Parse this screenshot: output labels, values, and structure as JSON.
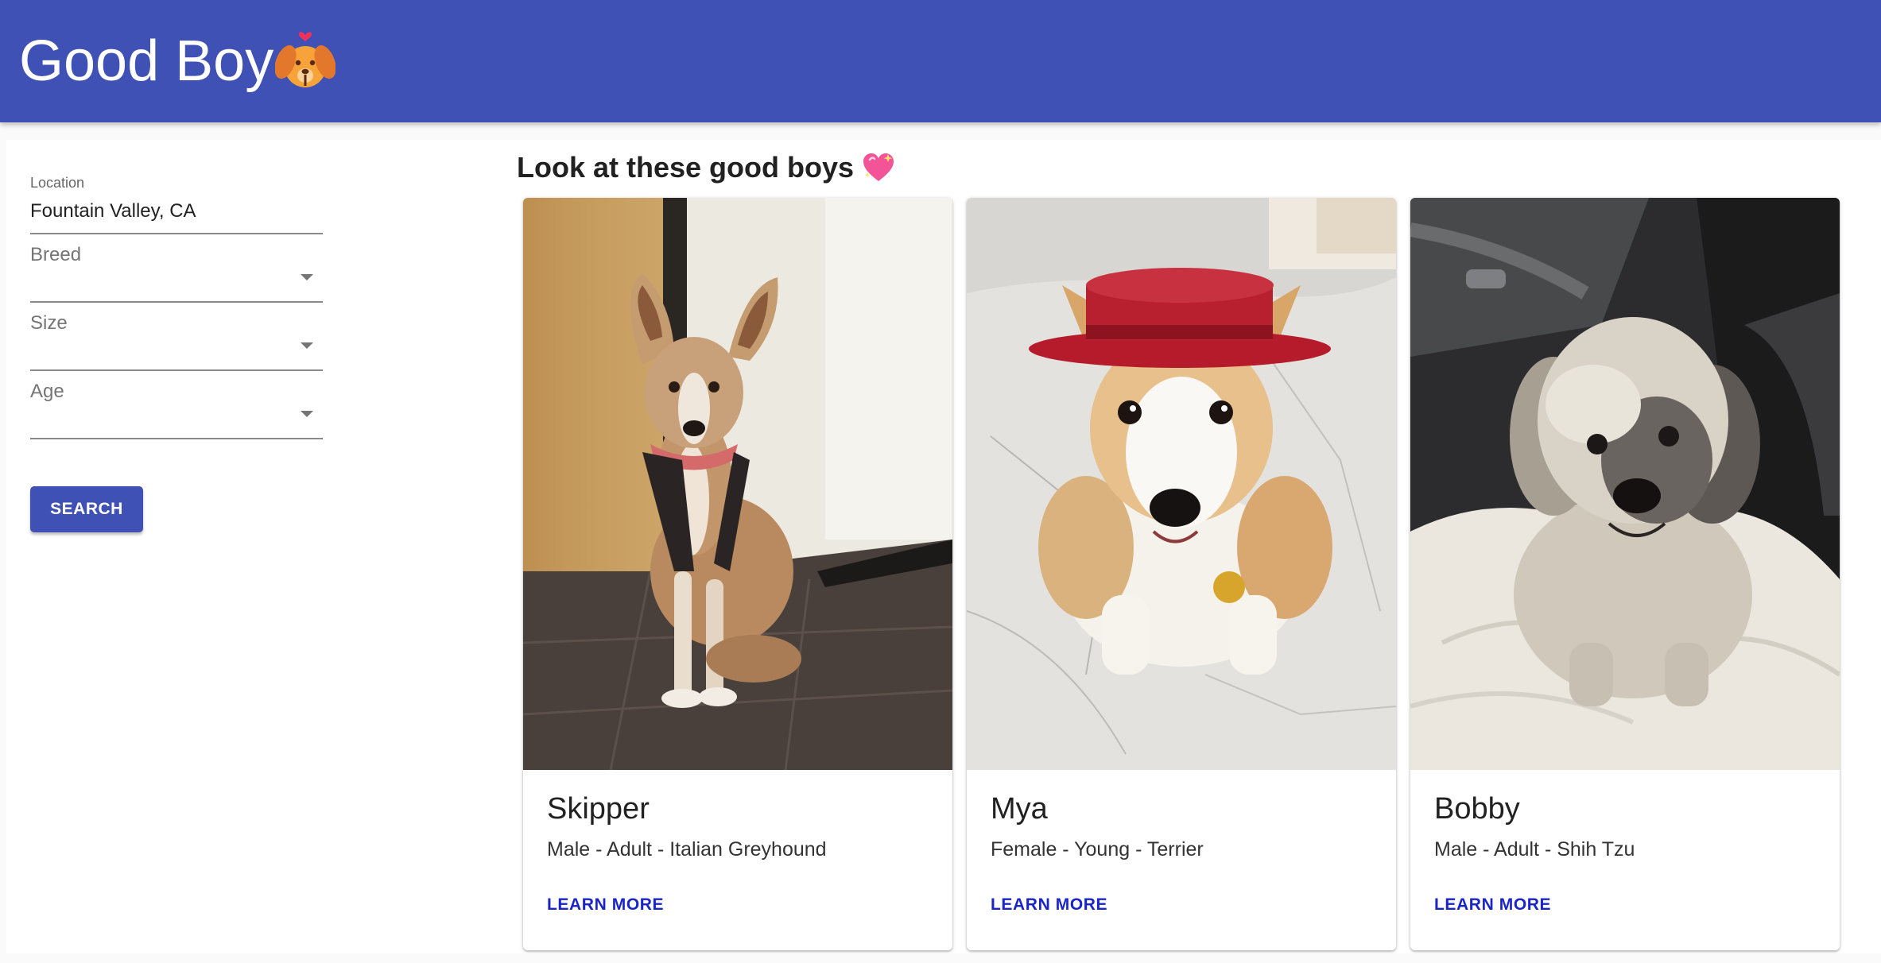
{
  "header": {
    "title": "Good Boy",
    "logo_icon": "puppy-face-with-heart-icon",
    "background": "#3f51b5"
  },
  "sidebar": {
    "location": {
      "label": "Location",
      "value": "Fountain Valley, CA"
    },
    "breed": {
      "label": "Breed",
      "value": ""
    },
    "size": {
      "label": "Size",
      "value": ""
    },
    "age": {
      "label": "Age",
      "value": ""
    },
    "search_label": "SEARCH"
  },
  "main": {
    "title": "Look at these good boys",
    "title_icon": "sparkling-heart-icon",
    "cards": [
      {
        "name": "Skipper",
        "description": "Male - Adult - Italian Greyhound",
        "action": "LEARN MORE",
        "photo": "dog-photo-skipper"
      },
      {
        "name": "Mya",
        "description": "Female - Young - Terrier",
        "action": "LEARN MORE",
        "photo": "dog-photo-mya"
      },
      {
        "name": "Bobby",
        "description": "Male - Adult - Shih Tzu",
        "action": "LEARN MORE",
        "photo": "dog-photo-bobby"
      }
    ]
  },
  "colors": {
    "primary": "#3f51b5",
    "link": "#1a24c9"
  }
}
